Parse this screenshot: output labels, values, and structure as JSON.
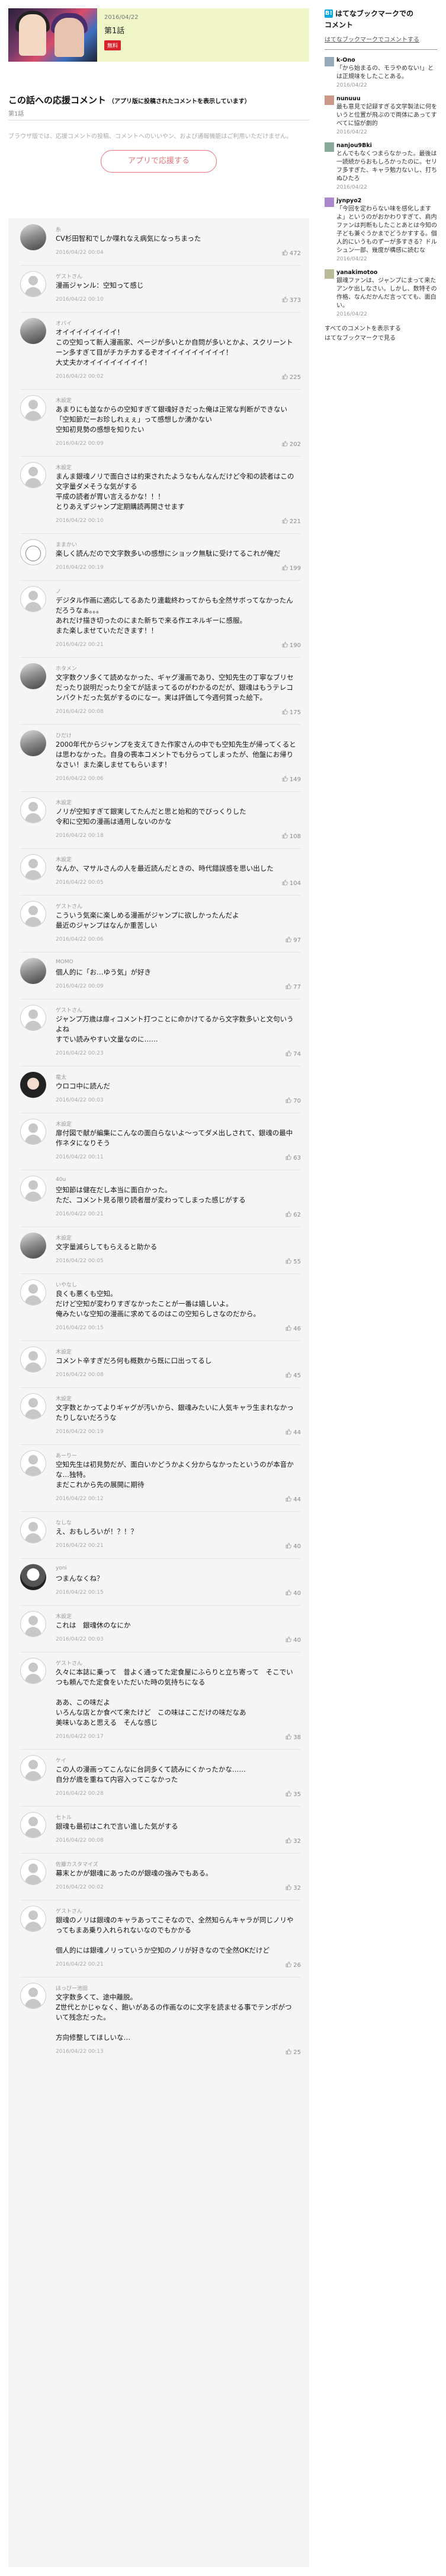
{
  "episode": {
    "date": "2016/04/22",
    "title": "第1話",
    "badge": "無料"
  },
  "comments_section": {
    "title": "この話への応援コメント",
    "note": "（アプリ版に投稿されたコメントを表示しています）",
    "page": "第1話",
    "notice": "ブラウザ版では、応援コメントの投稿、コメントへのいいやン、および通報機能はご利用いただけません。",
    "app_button": "アプリで応援する"
  },
  "comments": [
    {
      "user": "糸",
      "text": "CV杉田智和でしか喋れなえ病気になっちまった",
      "date": "2016/04/22 00:04",
      "likes": "472",
      "avatar": "img"
    },
    {
      "user": "ゲストさん",
      "text": "漫画ジャンル：空知って感じ",
      "date": "2016/04/22 00:10",
      "likes": "373",
      "avatar": "anon"
    },
    {
      "user": "オバイ",
      "text": "オイイイイイイイイ！\nこの空知って新人漫画家、ページが多いとか自問が多いとかよ、スクリーントーン多すぎて目がチカチカするぞオイイイイイイイイイ！\n大丈夫かオイイイイイイイイ！",
      "date": "2016/04/22 00:02",
      "likes": "225",
      "avatar": "img"
    },
    {
      "user": "木設定",
      "text": "あまりにも並なからの空知すぎて銀魂好きだった俺は正常な判断ができない\n「空知節だーお珍しれぇぇ」って感想しか湧かない\n空知初見勢の感想を知りたい",
      "date": "2016/04/22 00:09",
      "likes": "202",
      "avatar": "anon"
    },
    {
      "user": "木設定",
      "text": "まんま銀魂ノリで面白さは約束されたようなもんなんだけど令和の読者はこの文字量ダメそうな気がする\n平成の読者が胃い言えるかな！！！\nとりあえずジャンプ定期購読再開させます",
      "date": "2016/04/22 00:10",
      "likes": "221",
      "avatar": "anon"
    },
    {
      "user": "ままかい",
      "text": "楽しく読んだので文字数多いの感想にショック無駄に受けてるこれが俺だ",
      "date": "2016/04/22 00:19",
      "likes": "199",
      "avatar": "cat"
    },
    {
      "user": "ノ",
      "text": "デジタル作画に適応してるあたり連載終わってからも全然サボってなかったんだろうなぁ。。。\nあれだけ描き切ったのにまた新ちで来る作エネルギーに感服。\nまた楽しませていただきます！！",
      "date": "2016/04/22 00:21",
      "likes": "190",
      "avatar": "anon"
    },
    {
      "user": "ホタメン",
      "text": "文字数クソ多くて読めなかった、ギャグ漫画であり、空知先生の丁寧なブリセだったり説明だったり全てが話まってるのがわかるのだが、銀魂はもうテレコンバクトだった気がするのになー。実は評価して今週何質った絵下。",
      "date": "2016/04/22 00:08",
      "likes": "175",
      "avatar": "img"
    },
    {
      "user": "ひだけ",
      "text": "2000年代からジャンプを支えてきた作家さんの中でも空知先生が帰ってくるとは思わなかった。自身の喪本コメントでも分らってしまったが、他盤にお帰りなさい！また楽しませてもらいます！",
      "date": "2016/04/22 00:06",
      "likes": "149",
      "avatar": "img"
    },
    {
      "user": "木設定",
      "text": "ノリが空知すぎて銀実してたんだと思と始和的でびっくりした\n令和に空知の漫画は通用しないのかな",
      "date": "2016/04/22 00:18",
      "likes": "108",
      "avatar": "anon"
    },
    {
      "user": "木設定",
      "text": "なんか、マサルさんの人を最近読んだときの、時代錯誤感を思い出した",
      "date": "2016/04/22 00:05",
      "likes": "104",
      "avatar": "anon"
    },
    {
      "user": "ゲストさん",
      "text": "こういう気楽に楽しめる漫画がジャンプに欲しかったんだよ\n最近のジャンプはなんか重苦しい",
      "date": "2016/04/22 00:06",
      "likes": "97",
      "avatar": "anon"
    },
    {
      "user": "MOMO",
      "text": "個人的に「お…ゆう気」が好き",
      "date": "2016/04/22 00:09",
      "likes": "77",
      "avatar": "img"
    },
    {
      "user": "ゲストさん",
      "text": "ジャンプ万歳は扉ィコメント打つことに命かけてるから文字数多いと文句いうよね\nすでい読みやすい文量なのに……",
      "date": "2016/04/22 00:23",
      "likes": "74",
      "avatar": "anon"
    },
    {
      "user": "竜太",
      "text": "ウロコ中に読んだ",
      "date": "2016/04/22 00:03",
      "likes": "70",
      "avatar": "dark"
    },
    {
      "user": "木設定",
      "text": "扉付図で献が編集にこんなの面白らないよ〜ってダメ出しされて、銀魂の最中作ネタになりそう",
      "date": "2016/04/22 00:11",
      "likes": "63",
      "avatar": "anon"
    },
    {
      "user": "40u",
      "text": "空知節は健在だし本当に面白かった。\nただ、コメント見る限り読者層が変わってしまった感じがする",
      "date": "2016/04/22 00:21",
      "likes": "62",
      "avatar": "anon"
    },
    {
      "user": "木設定",
      "text": "文字量減らしてもらえると助かる",
      "date": "2016/04/22 00:05",
      "likes": "55",
      "avatar": "img"
    },
    {
      "user": "いやなし",
      "text": "良くも悪くも空知。\nだけど空知が変わりすぎなかったことが一番は嬉しいよ。\n俺みたいな空知の漫画に求めてるのはこの空知らしさなのだから。",
      "date": "2016/04/22 00:15",
      "likes": "46",
      "avatar": "anon"
    },
    {
      "user": "木設定",
      "text": "コメント辛すぎだろ何も概数から既に口出ってるし",
      "date": "2016/04/22 00:08",
      "likes": "45",
      "avatar": "anon"
    },
    {
      "user": "木設定",
      "text": "文字数とかってよりギャグが汚いから、銀魂みたいに人気キャラ生まれなかったりしないだろうな",
      "date": "2016/04/22 00:19",
      "likes": "44",
      "avatar": "anon"
    },
    {
      "user": "あーりー",
      "text": "空知先生は初見勢だが、面白いかどうかよく分からなかったというのが本音かな…独特。\nまだこれから先の展開に期待",
      "date": "2016/04/22 00:12",
      "likes": "44",
      "avatar": "anon"
    },
    {
      "user": "なしな",
      "text": "え、おもしろいが！？！？",
      "date": "2016/04/22 00:21",
      "likes": "40",
      "avatar": "anon"
    },
    {
      "user": "yoni",
      "text": "つまんなくね？",
      "date": "2016/04/22 00:15",
      "likes": "40",
      "avatar": "mono"
    },
    {
      "user": "木設定",
      "text": "これは　銀魂休のなにか",
      "date": "2016/04/22 00:03",
      "likes": "40",
      "avatar": "anon"
    },
    {
      "user": "ゲストさん",
      "text": "久々に本誌に乗って　昔よく通ってた定食屋にふらりと立ち寄って　そこでいつも頼んでた定食をいただいた時の気持ちになる\n\nああ、この味だよ\nいろんな店とか食べて来たけど　この味はここだけの味だなあ\n美味いなあと思える　そんな感じ",
      "date": "2016/04/22 00:17",
      "likes": "38",
      "avatar": "anon"
    },
    {
      "user": "ケイ",
      "text": "この人の漫画ってこんなに台詞多くて読みにくかったかな……\n自分が歳を重ねて内容入ってこなかった",
      "date": "2016/04/22 00:28",
      "likes": "35",
      "avatar": "anon"
    },
    {
      "user": "七トル",
      "text": "銀魂も最初はこれで言い進した気がする",
      "date": "2016/04/22 00:08",
      "likes": "32",
      "avatar": "anon"
    },
    {
      "user": "佐藤カスタマイズ",
      "text": "幕末とかが銀魂にあったのが銀魂の強みでもある。",
      "date": "2016/04/22 00:02",
      "likes": "32",
      "avatar": "anon"
    },
    {
      "user": "ゲストさん",
      "text": "銀魂のノリは銀魂のキャラあってこそなので、全然知らんキャラが同じノリやってもまあ乗り入れられないなのでもかかる\n\n個人的には銀魂ノリっていうか空知のノリが好きなので全然OKだけど",
      "date": "2016/04/22 00:21",
      "likes": "26",
      "avatar": "anon"
    },
    {
      "user": "ほっぴー池田",
      "text": "文字数多くて、途中離脱。\nZ世代とかじゃなく、飽いがあるの作画なのに文字を読ませる事でテンポがついて残念だった。\n\n方向修整してほしいな…",
      "date": "2016/04/22 00:13",
      "likes": "25",
      "avatar": "anon"
    }
  ],
  "sidebar": {
    "title": "はてなブックマークでの",
    "title2": "コメント",
    "more_top": "はてなブックマークでコメントする",
    "bookmarks": [
      {
        "user": "k-Ono",
        "text": "「から始まるの、モラやめない!」とは正規味をしたことある。",
        "date": "2016/04/22"
      },
      {
        "user": "nunuuu",
        "text": "最も意見で記録すぎる文学製法に何をいうと位置が飛ぶので両体にあってすべてに協が劇的",
        "date": "2016/04/22"
      },
      {
        "user": "nanjou9Bki",
        "text": "とんでもなくつまらなかった。最後は一読続からおもしろかったのに。セリフ多すぎた、キャラ勉力ないし、打ちぬひたろ",
        "date": "2016/04/22"
      },
      {
        "user": "jynpyo2",
        "text": "「今回を定わらない味を感化しますよ」というのがおかわりすぎて、肩内ファンは判断もしたことあとは今知の子ども兼ぐうかまでどうかすする。個人的にいうものずーが多すきる？ドルシュン一部、幾度が構感に読むな",
        "date": "2016/04/22"
      },
      {
        "user": "yanakimotoo",
        "text": "銀魂ファンは、ジャンプにまって来たアンケ出しなさい。しかし、数特その作格、なんだかんだ言ってても、面白い。",
        "date": "2016/04/22"
      }
    ],
    "foot_all": "すべてのコメントを表示する",
    "foot_more": "はてなブックマークで見る"
  }
}
